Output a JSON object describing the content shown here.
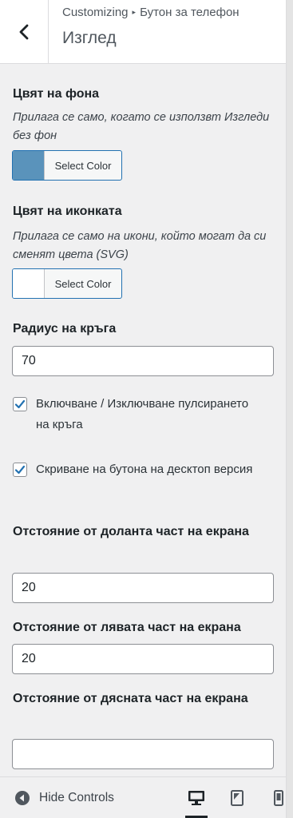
{
  "header": {
    "breadcrumb_root": "Customizing",
    "breadcrumb_separator": "▸",
    "breadcrumb_panel": "Бутон за телефон",
    "section_title": "Изглед"
  },
  "fields": {
    "bg_color": {
      "label": "Цвят на фона",
      "description": "Прилага се само, когато се използвт Изгледи без фон",
      "button_label": "Select Color",
      "swatch_color": "#5a93bb"
    },
    "icon_color": {
      "label": "Цвят на иконката",
      "description": "Прилага се само на икони, който могат да си сменят цвета (SVG)",
      "button_label": "Select Color",
      "swatch_color": "#ffffff"
    },
    "radius": {
      "label": "Радиус на кръга",
      "value": "70"
    },
    "pulse": {
      "label": "Включване / Изключване пулсирането на кръга",
      "checked": true
    },
    "hide_desktop": {
      "label": "Скриване на бутона на десктоп версия",
      "checked": true
    },
    "offset_bottom": {
      "label": "Отстояние от доланта част на екрана",
      "value": "20"
    },
    "offset_left": {
      "label": "Отстояние от лявата част на екрана",
      "value": "20"
    },
    "offset_right": {
      "label": "Отстояние от дясната част на екрана",
      "value": ""
    }
  },
  "footer": {
    "hide_controls_label": "Hide Controls",
    "devices": [
      "desktop",
      "tablet",
      "mobile"
    ],
    "active_device": "desktop"
  },
  "colors": {
    "accent": "#2271b1",
    "check": "#2271b1"
  }
}
